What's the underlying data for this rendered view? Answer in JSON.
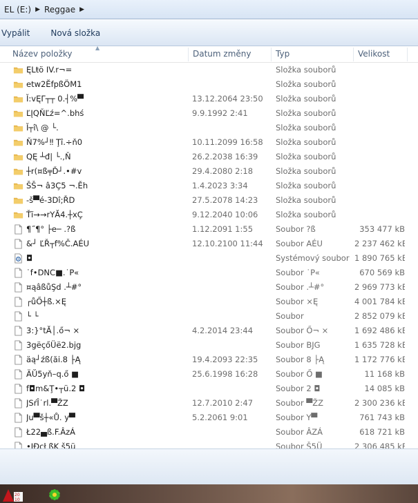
{
  "address": {
    "drive": "EL (E:)",
    "folder": "Reggae"
  },
  "toolbar": {
    "burn": "Vypálit",
    "new_folder": "Nová složka"
  },
  "columns": {
    "name": "Název položky",
    "date": "Datum změny",
    "type": "Typ",
    "size": "Velikost"
  },
  "rows": [
    {
      "icon": "folder",
      "name": "ĘLŧö IV.r¬=",
      "date": "",
      "type": "Složka souborů",
      "size": ""
    },
    {
      "icon": "folder",
      "name": "etw2ĔfpßÖM1",
      "date": "",
      "type": "Složka souborů",
      "size": ""
    },
    {
      "icon": "folder",
      "name": "Ĭ:vĘΓ┬┬ 0.┤%▀",
      "date": "13.12.2064 23:50",
      "type": "Složka souborů",
      "size": ""
    },
    {
      "icon": "folder",
      "name": "ĽĮQŇĽź=^.bhś",
      "date": "9.9.1992 2:41",
      "type": "Složka souborů",
      "size": ""
    },
    {
      "icon": "folder",
      "name": "Ĭ┬î\\ @ └.",
      "date": "",
      "type": "Složka souborů",
      "size": ""
    },
    {
      "icon": "folder",
      "name": "Ň7%┘‼ Ţî.÷ň0",
      "date": "10.11.2099 16:58",
      "type": "Složka souborů",
      "size": ""
    },
    {
      "icon": "folder",
      "name": "QĘ ┴đ| └.,Ň",
      "date": "26.2.2038 16:39",
      "type": "Složka souborů",
      "size": ""
    },
    {
      "icon": "folder",
      "name": "┼r(¤ß╤Ď┘.•#v",
      "date": "29.4.2080 2:18",
      "type": "Složka souborů",
      "size": ""
    },
    {
      "icon": "folder",
      "name": "ŠŠ¬ â3Ç5 ¬.Ěh",
      "date": "1.4.2023 3:34",
      "type": "Složka souborů",
      "size": ""
    },
    {
      "icon": "folder",
      "name": "-š▀é-3Dî;ŘD",
      "date": "27.5.2078 14:23",
      "type": "Složka souborů",
      "size": ""
    },
    {
      "icon": "folder",
      "name": "Ťĭ→→rYĂ4.┼xÇ",
      "date": "9.12.2040 10:06",
      "type": "Složka souborů",
      "size": ""
    },
    {
      "icon": "file",
      "name": "¶˝¶° ├e─ .?ß",
      "date": "1.12.2091 1:55",
      "type": "Soubor ?ß",
      "size": "353 477 kB"
    },
    {
      "icon": "file",
      "name": "&┘ ĽŘ┬f%Č.AÉU",
      "date": "12.10.2100 11:44",
      "type": "Soubor AÉU",
      "size": "2 237 462 kB"
    },
    {
      "icon": "system",
      "name": "◘",
      "date": "",
      "type": "Systémový soubor",
      "size": "1 890 765 kB"
    },
    {
      "icon": "file",
      "name": "˙f•DNC■.˙P«",
      "date": "",
      "type": "Soubor ˙P«",
      "size": "670 569 kB"
    },
    {
      "icon": "file",
      "name": "¤ąâßůŞd .┴#°",
      "date": "",
      "type": "Soubor .┴#°",
      "size": "2 969 773 kB"
    },
    {
      "icon": "file",
      "name": "┌ůŐ┼ß.×Ę",
      "date": "",
      "type": "Soubor ×Ę",
      "size": "4 001 784 kB"
    },
    {
      "icon": "file",
      "name": "└ └",
      "date": "",
      "type": "Soubor",
      "size": "2 852 079 kB"
    },
    {
      "icon": "file",
      "name": "3:}°tĂ│.ő¬ ×",
      "date": "4.2.2014 23:44",
      "type": "Soubor Ő¬ ×",
      "size": "1 692 486 kB"
    },
    {
      "icon": "file",
      "name": "3gëçőÜë2.bjg",
      "date": "",
      "type": "Soubor BJG",
      "size": "1 635 728 kB"
    },
    {
      "icon": "file",
      "name": "äą┘źß(ăi.8 ├Ą",
      "date": "19.4.2093 22:35",
      "type": "Soubor 8 ├Ą",
      "size": "1 172 776 kB"
    },
    {
      "icon": "file",
      "name": "ÄŬ5yň–q.ő ■",
      "date": "25.6.1998 16:28",
      "type": "Soubor Ő ■",
      "size": "11 168 kB"
    },
    {
      "icon": "file",
      "name": "f◘m&Ţ•┬ü.2 ◘",
      "date": "",
      "type": "Soubor 2 ◘",
      "size": "14 085 kB"
    },
    {
      "icon": "file",
      "name": "JSŕÎ˙rl.▀ŽZ",
      "date": "12.7.2010 2:47",
      "type": "Soubor ▀ŽZ",
      "size": "2 300 236 kB"
    },
    {
      "icon": "file",
      "name": "Ju▀š┼«Ů. y▀",
      "date": "5.2.2061 9:01",
      "type": "Soubor Y▀",
      "size": "761 743 kB"
    },
    {
      "icon": "file",
      "name": "Ł22▄ß.F.ÂzÁ",
      "date": "",
      "type": "Soubor ÂZÁ",
      "size": "618 721 kB"
    },
    {
      "icon": "file",
      "name": "•ĮĐcł ßK š5ü",
      "date": "",
      "type": "Soubor Š5Ü",
      "size": "2 306 485 kB"
    }
  ],
  "taskbar": {
    "badge": "2010"
  },
  "colors": {
    "folder": "#e9b94c",
    "header_text": "#4c607a",
    "secondary_text": "#6d6d6d"
  }
}
